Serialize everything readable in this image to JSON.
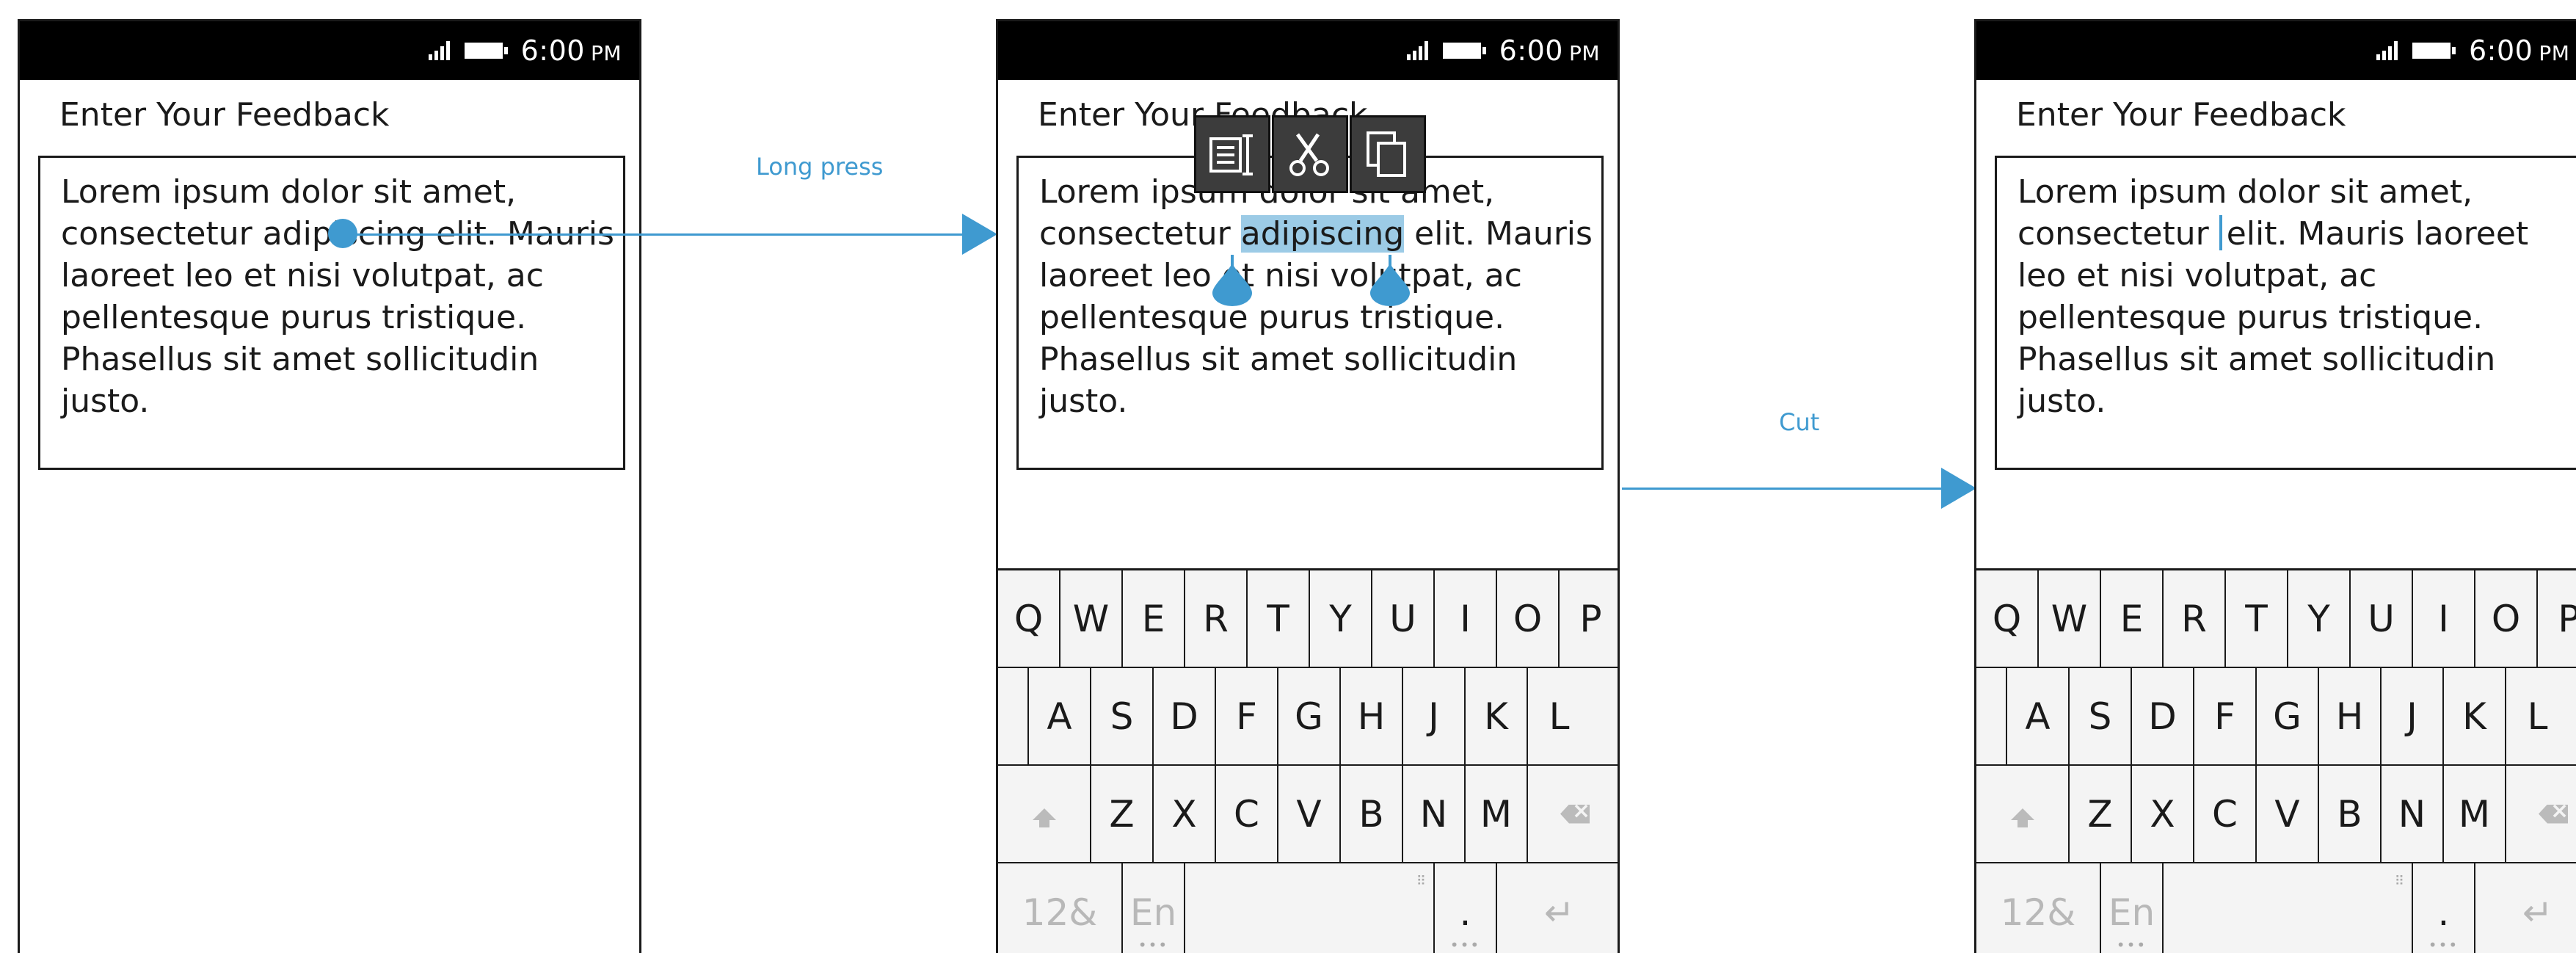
{
  "status_bar": {
    "time": "6:00",
    "ampm": "PM"
  },
  "screen": {
    "title": "Enter Your Feedback"
  },
  "text": {
    "line1": "Lorem ipsum dolor sit amet,",
    "line2": "consectetur adipiscing elit. Mauris",
    "line3": "laoreet leo et nisi volutpat, ac",
    "line4": "pellentesque purus tristique.",
    "line5": "Phasellus sit amet sollicitudin",
    "line6": "justo.",
    "line2_prefix": "consectetur ",
    "selected_word": "adipiscing",
    "line2_suffix": " elit. Mauris",
    "after_cut": {
      "line1": "Lorem ipsum dolor sit amet,",
      "line2_prefix": "consectetur ",
      "line2_suffix": "elit. Mauris laoreet",
      "line3": "leo et nisi volutpat, ac",
      "line4": "pellentesque purus tristique.",
      "line5": "Phasellus sit amet sollicitudin",
      "line6": "justo."
    }
  },
  "context_menu": {
    "icons": [
      "select-all-icon",
      "cut-icon",
      "copy-icon"
    ]
  },
  "transitions": {
    "long_press": "Long press",
    "cut": "Cut"
  },
  "keyboard": {
    "row1": [
      "Q",
      "W",
      "E",
      "R",
      "T",
      "Y",
      "U",
      "I",
      "O",
      "P"
    ],
    "row2": [
      "A",
      "S",
      "D",
      "F",
      "G",
      "H",
      "J",
      "K",
      "L"
    ],
    "row3": [
      "Z",
      "X",
      "C",
      "V",
      "B",
      "N",
      "M"
    ],
    "numbers_key": "12&",
    "language_key": "En",
    "period_key": ".",
    "enter_symbol": "↵"
  },
  "colors": {
    "accent": "#3f9ad0",
    "selection": "#9ccbe6",
    "statusbar": "#000000",
    "keyboard_bg": "#f4f4f4"
  }
}
